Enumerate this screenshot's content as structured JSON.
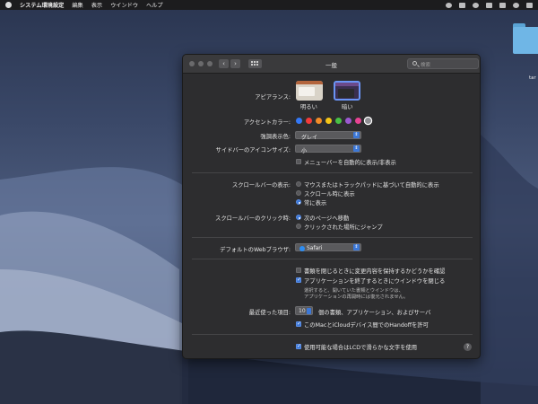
{
  "menubar": {
    "app": "システム環境設定",
    "items": [
      "編集",
      "表示",
      "ウインドウ",
      "ヘルプ"
    ]
  },
  "desktop": {
    "folder_label": "tar"
  },
  "window": {
    "title": "一般",
    "search_placeholder": "検索",
    "nav_back": "‹",
    "nav_forward": "›"
  },
  "appearance": {
    "label": "アピアランス:",
    "options": [
      "明るい",
      "暗い"
    ],
    "selected": "暗い"
  },
  "accent": {
    "label": "アクセントカラー:",
    "colors": [
      "#3478f6",
      "#f23b3b",
      "#f28c28",
      "#f5c518",
      "#48c145",
      "#9b59d0",
      "#e84393",
      "#8e8e93"
    ],
    "selected": "#8e8e93"
  },
  "highlight": {
    "label": "強調表示色:",
    "value": "グレイ"
  },
  "sidebar_icon_size": {
    "label": "サイドバーのアイコンサイズ:",
    "value": "小"
  },
  "auto_hide_menubar": {
    "label": "メニューバーを自動的に表示/非表示",
    "checked": false
  },
  "scrollbars": {
    "label": "スクロールバーの表示:",
    "options": [
      "マウスまたはトラックパッドに基づいて自動的に表示",
      "スクロール時に表示",
      "常に表示"
    ],
    "selected": 2
  },
  "scrollbar_click": {
    "label": "スクロールバーのクリック時:",
    "options": [
      "次のページへ移動",
      "クリックされた場所にジャンプ"
    ],
    "selected": 0
  },
  "browser": {
    "label": "デフォルトのWebブラウザ:",
    "value": "Safari"
  },
  "ask_keep_changes": {
    "label": "書類を閉じるときに変更内容を保持するかどうかを確認",
    "checked": false
  },
  "close_windows": {
    "label": "アプリケーションを終了するときにウインドウを閉じる",
    "checked": true,
    "note_line1": "選択すると、開いていた書類とウインドウは、",
    "note_line2": "アプリケーションの再開時には復元されません。"
  },
  "recent_items": {
    "label": "最近使った項目:",
    "value": "10",
    "suffix": "個の書類、アプリケーション、およびサーバ"
  },
  "handoff": {
    "label": "このMacとiCloudデバイス間でのHandoffを許可",
    "checked": true
  },
  "lcd_smoothing": {
    "label": "使用可能な場合はLCDで滑らかな文字を使用",
    "checked": true
  },
  "help_label": "?"
}
